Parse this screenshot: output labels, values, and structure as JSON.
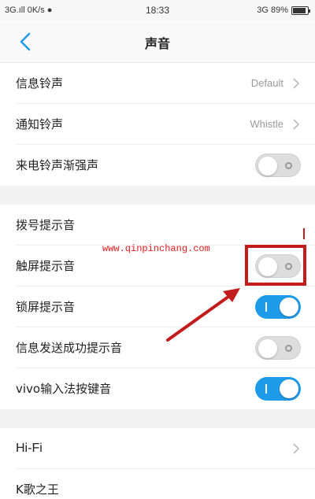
{
  "status_bar": {
    "left_text": "3G.ıll  0K/s ●",
    "time": "18:33",
    "right_text": "3G 89%",
    "battery_level": 0.89
  },
  "header": {
    "back_icon": "chevron-left-icon",
    "title": "声音"
  },
  "rows": [
    {
      "label": "信息铃声",
      "value": "Default",
      "control": "chevron"
    },
    {
      "label": "通知铃声",
      "value": "Whistle",
      "control": "chevron"
    },
    {
      "label": "来电铃声渐强声",
      "control": "toggle",
      "state": "off"
    },
    {
      "label": "拨号提示音",
      "control": "none"
    },
    {
      "label": "触屏提示音",
      "control": "toggle",
      "state": "off"
    },
    {
      "label": "锁屏提示音",
      "control": "toggle",
      "state": "on"
    },
    {
      "label": "信息发送成功提示音",
      "control": "toggle",
      "state": "off"
    },
    {
      "label": "vivo输入法按键音",
      "control": "toggle",
      "state": "on"
    },
    {
      "label": "Hi-Fi",
      "control": "chevron"
    },
    {
      "label": "K歌之王",
      "control": "none"
    }
  ],
  "watermark": "www.qinpinchang.com",
  "colors": {
    "toggle_on": "#1e9be8",
    "toggle_off": "#dddddd",
    "annotation_red": "#c21b1b",
    "back_arrow": "#1e9be8"
  }
}
